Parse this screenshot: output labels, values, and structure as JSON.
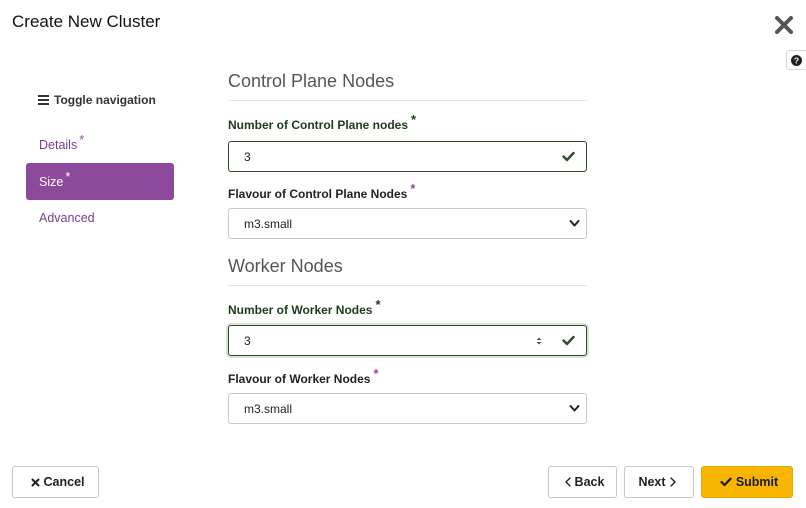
{
  "modal": {
    "title": "Create New Cluster"
  },
  "sidebar": {
    "toggle_label": "Toggle navigation",
    "items": [
      {
        "label": "Details",
        "required": "*"
      },
      {
        "label": "Size",
        "required": "*"
      },
      {
        "label": "Advanced",
        "required": ""
      }
    ]
  },
  "control_plane": {
    "section_title": "Control Plane Nodes",
    "count_label": "Number of Control Plane nodes",
    "count_required": "*",
    "count_value": "3",
    "flavour_label": "Flavour of Control Plane Nodes",
    "flavour_required": "*",
    "flavour_value": "m3.small"
  },
  "worker": {
    "section_title": "Worker Nodes",
    "count_label": "Number of Worker Nodes",
    "count_required": "*",
    "count_value": "3",
    "flavour_label": "Flavour of Worker Nodes",
    "flavour_required": "*",
    "flavour_value": "m3.small"
  },
  "footer": {
    "cancel_label": "Cancel",
    "back_label": "Back",
    "next_label": "Next",
    "submit_label": "Submit"
  },
  "colors": {
    "nav_active": "#8d4a9c",
    "link": "#7a3c8c",
    "valid": "#2b4a25",
    "submit": "#f7b500"
  }
}
